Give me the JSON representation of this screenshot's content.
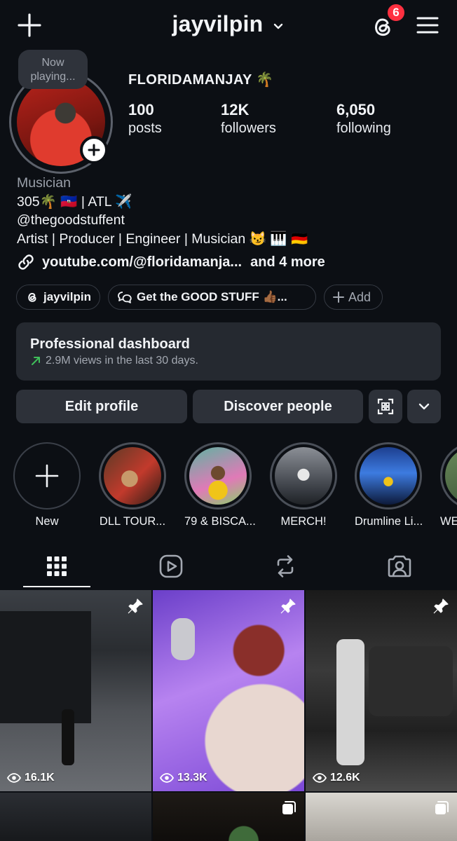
{
  "header": {
    "username": "jayvilpin",
    "notifications_badge": "6"
  },
  "profile": {
    "now_playing": "Now playing...",
    "display_name": "FLORIDAMANJAY 🌴",
    "stats": [
      {
        "num": "100",
        "label": "posts"
      },
      {
        "num": "12K",
        "label": "followers"
      },
      {
        "num": "6,050",
        "label": "following"
      }
    ],
    "category": "Musician",
    "bio_lines": [
      "305🌴 🇭🇹 | ATL ✈️",
      "@thegoodstuffent",
      "Artist | Producer | Engineer | Musician 😼 🎹 🇩🇪"
    ],
    "link": "youtube.com/@floridamanja...",
    "link_more": "and 4 more",
    "chips": [
      "jayvilpin",
      "Get the GOOD STUFF 👍🏾...",
      "Add"
    ]
  },
  "dashboard": {
    "title": "Professional dashboard",
    "subtitle": "2.9M views in the last 30 days."
  },
  "actions": {
    "edit": "Edit profile",
    "discover": "Discover people"
  },
  "highlights": [
    "New",
    "DLL TOUR...",
    "79 & BISCA...",
    "MERCH!",
    "Drumline Li...",
    "WE"
  ],
  "grid": {
    "views": [
      "16.1K",
      "13.3K",
      "12.6K"
    ]
  },
  "colors": {
    "background": "#0c0f14",
    "surface": "#252930",
    "badge": "#ff3040",
    "trend": "#3fbf5a"
  }
}
